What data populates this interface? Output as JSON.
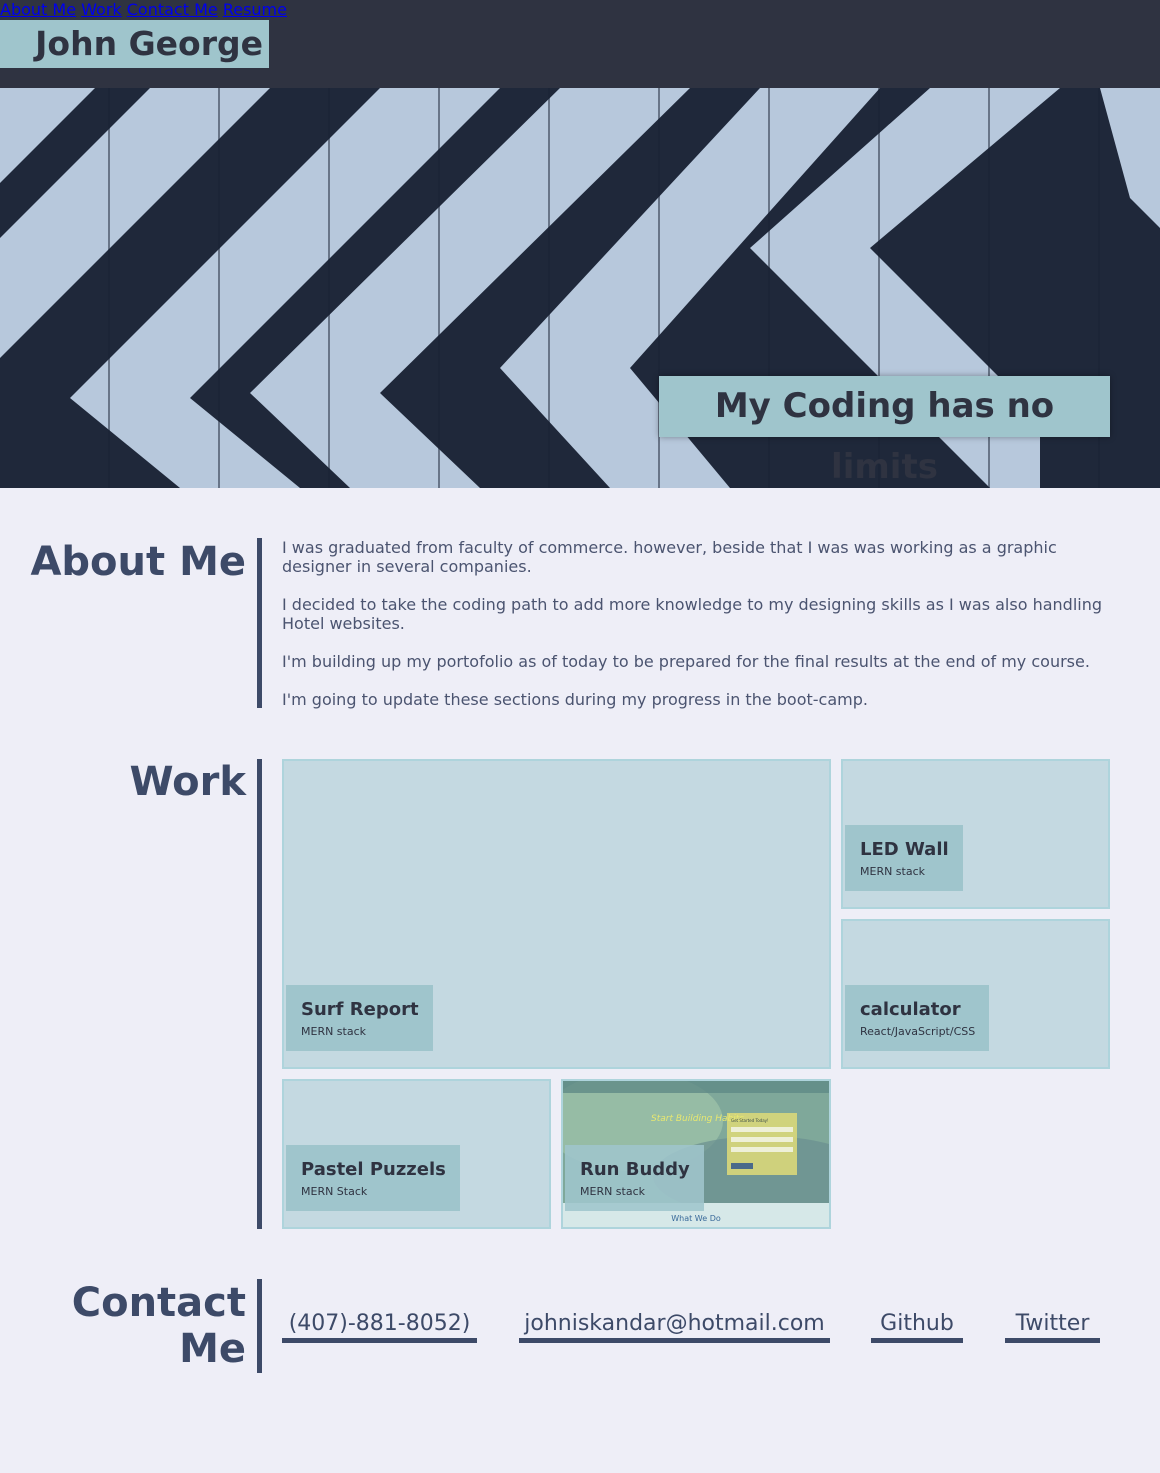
{
  "header": {
    "brand": "John George",
    "nav": [
      {
        "label": "About Me"
      },
      {
        "label": "Work"
      },
      {
        "label": "Contact Me"
      },
      {
        "label": "Resume"
      }
    ]
  },
  "hero": {
    "tagline": "My Coding has no limits"
  },
  "about": {
    "title": "About Me",
    "paragraphs": [
      "I was graduated from faculty of commerce. however, beside that I was was working as a graphic designer in several companies.",
      "I decided to take the coding path to add more knowledge to my designing skills as I was also handling Hotel websites.",
      "I'm building up my portofolio as of today to be prepared for the final results at the end of my course.",
      "I'm going to update these sections during my progress in the boot-camp."
    ]
  },
  "work": {
    "title": "Work",
    "projects": [
      {
        "name": "Surf Report",
        "stack": "MERN stack"
      },
      {
        "name": "LED Wall",
        "stack": "MERN stack"
      },
      {
        "name": "calculator",
        "stack": "React/JavaScript/CSS"
      },
      {
        "name": "Pastel Puzzels",
        "stack": "MERN Stack"
      },
      {
        "name": "Run Buddy",
        "stack": "MERN stack"
      }
    ],
    "run_buddy_screenshot": {
      "headline": "Start Building Habits",
      "form_title": "Get Started Today!",
      "footer": "What We Do"
    }
  },
  "contact": {
    "title_line1": "Contact",
    "title_line2": "Me",
    "links": [
      {
        "label": "(407)-881-8052)"
      },
      {
        "label": "johniskandar@hotmail.com"
      },
      {
        "label": "Github"
      },
      {
        "label": "Twitter"
      }
    ]
  },
  "colors": {
    "header_bg": "#2f3341",
    "accent": "#9fc5cc",
    "page_bg": "#eeeef7",
    "heading": "#3d4a68",
    "tile_bg": "#c4d9e1"
  }
}
